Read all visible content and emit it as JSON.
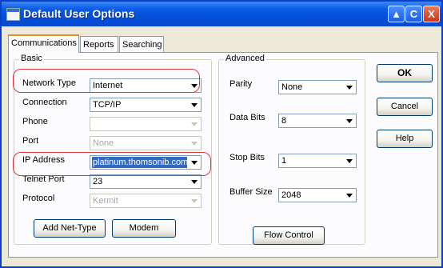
{
  "window": {
    "title": "Default User Options"
  },
  "title_buttons": {
    "help": "▲",
    "back": "C",
    "close": "X"
  },
  "tabs": [
    {
      "label": "Communications"
    },
    {
      "label": "Reports"
    },
    {
      "label": "Searching"
    }
  ],
  "basic": {
    "title": "Basic",
    "fields": [
      {
        "label": "Network Type",
        "value": "Internet",
        "enabled": true
      },
      {
        "label": "Connection",
        "value": "TCP/IP",
        "enabled": true
      },
      {
        "label": "Phone",
        "value": "",
        "enabled": false
      },
      {
        "label": "Port",
        "value": "None",
        "enabled": false
      },
      {
        "label": "IP Address",
        "value": "platinum.thomsonib.com",
        "enabled": true,
        "selected": true
      },
      {
        "label": "Telnet Port",
        "value": "23",
        "enabled": true
      },
      {
        "label": "Protocol",
        "value": "Kermit",
        "enabled": false
      }
    ],
    "buttons": {
      "add_net_type": "Add Net-Type",
      "modem": "Modem"
    }
  },
  "advanced": {
    "title": "Advanced",
    "fields": [
      {
        "label": "Parity",
        "value": "None"
      },
      {
        "label": "Data Bits",
        "value": "8"
      },
      {
        "label": "Stop Bits",
        "value": "1"
      },
      {
        "label": "Buffer Size",
        "value": "2048"
      }
    ],
    "buttons": {
      "flow_control": "Flow Control"
    }
  },
  "dialog_buttons": {
    "ok": "OK",
    "cancel": "Cancel",
    "help": "Help"
  },
  "colors": {
    "highlight_annotation": "#d9383a",
    "titlebar": "#0a49cf"
  }
}
